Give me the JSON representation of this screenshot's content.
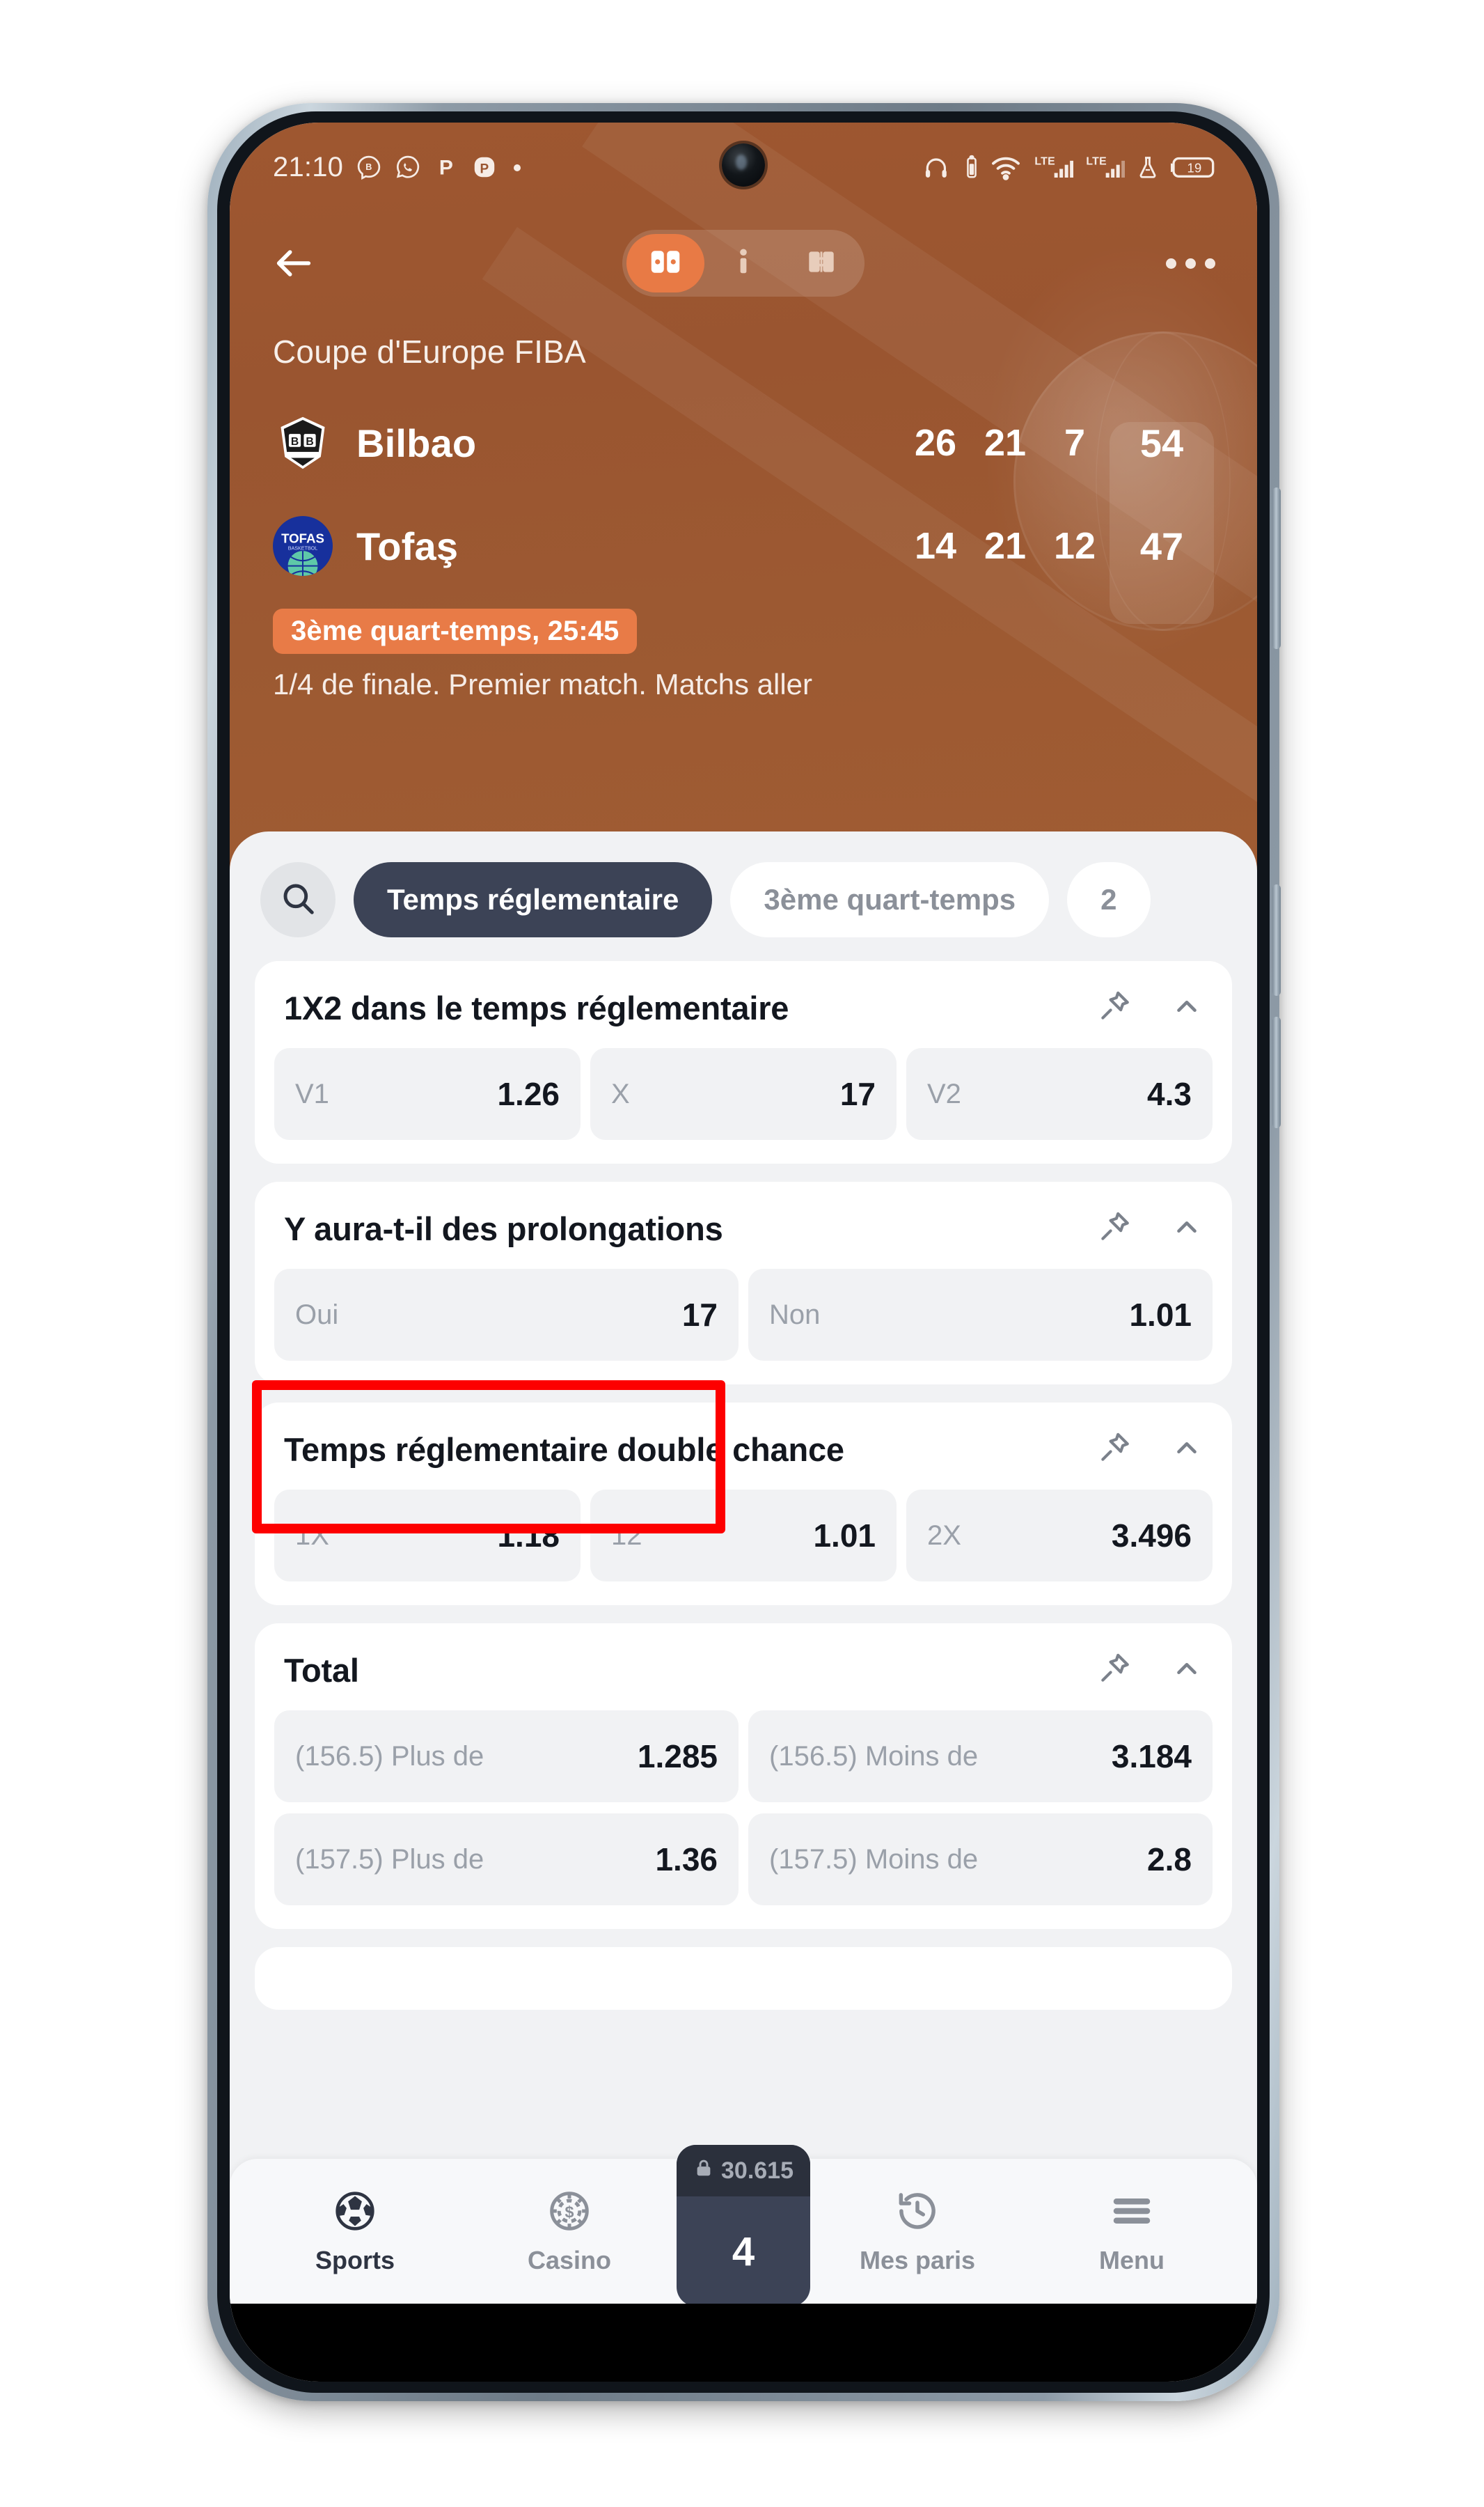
{
  "status_bar": {
    "time": "21:10",
    "left_icons": [
      "messenger-icon",
      "whatsapp-icon",
      "p-app-icon",
      "p-badge-icon",
      "dot-icon"
    ],
    "right_icons": [
      "headphones-icon",
      "battery-small-icon",
      "wifi-icon",
      "lte-signal-1-icon",
      "lte-signal-2-icon",
      "flask-icon"
    ],
    "battery_level": "19"
  },
  "nav": {
    "back_icon": "back-arrow-icon",
    "segments": [
      {
        "icon": "scoreboard-icon",
        "active": true
      },
      {
        "icon": "info-icon",
        "active": false
      },
      {
        "icon": "lineup-icon",
        "active": false
      }
    ],
    "more_icon": "more-options-icon"
  },
  "match": {
    "league": "Coupe d'Europe FIBA",
    "quarters_header": null,
    "teams": [
      {
        "name": "Bilbao",
        "logo": "bilbao-crest-logo",
        "quarters": [
          "26",
          "21",
          "7"
        ],
        "total": "54"
      },
      {
        "name": "Tofaş",
        "logo": "tofas-circle-logo",
        "quarters": [
          "14",
          "21",
          "12"
        ],
        "total": "47"
      }
    ],
    "live_status": "3ème quart-temps, 25:45",
    "stage_info": "1/4 de finale. Premier match. Matchs aller"
  },
  "filters": {
    "search_icon": "search-icon",
    "chips": [
      {
        "label": "Temps réglementaire",
        "active": true
      },
      {
        "label": "3ème quart-temps",
        "active": false
      },
      {
        "label": "2",
        "active": false
      }
    ]
  },
  "markets": [
    {
      "title": "1X2 dans le temps réglementaire",
      "pin_icon": "pin-icon",
      "collapse_icon": "chevron-up-icon",
      "rows": [
        [
          {
            "label": "V1",
            "value": "1.26"
          },
          {
            "label": "X",
            "value": "17"
          },
          {
            "label": "V2",
            "value": "4.3"
          }
        ]
      ]
    },
    {
      "title": "Y aura-t-il des prolongations",
      "pin_icon": "pin-icon",
      "collapse_icon": "chevron-up-icon",
      "highlighted": true,
      "rows": [
        [
          {
            "label": "Oui",
            "value": "17"
          },
          {
            "label": "Non",
            "value": "1.01"
          }
        ]
      ]
    },
    {
      "title": "Temps réglementaire double chance",
      "pin_icon": "pin-icon",
      "collapse_icon": "chevron-up-icon",
      "rows": [
        [
          {
            "label": "1X",
            "value": "1.18"
          },
          {
            "label": "12",
            "value": "1.01"
          },
          {
            "label": "2X",
            "value": "3.496"
          }
        ]
      ]
    },
    {
      "title": "Total",
      "pin_icon": "pin-icon",
      "collapse_icon": "chevron-up-icon",
      "rows": [
        [
          {
            "label": "(156.5) Plus de",
            "value": "1.285"
          },
          {
            "label": "(156.5) Moins de",
            "value": "3.184"
          }
        ],
        [
          {
            "label": "(157.5) Plus de",
            "value": "1.36"
          },
          {
            "label": "(157.5) Moins de",
            "value": "2.8"
          }
        ]
      ]
    }
  ],
  "bottom_nav": {
    "items": [
      {
        "label": "Sports",
        "icon": "soccer-ball-icon",
        "active": true
      },
      {
        "label": "Casino",
        "icon": "casino-chip-icon",
        "active": false
      },
      {
        "label": "Mes paris",
        "icon": "history-clock-icon",
        "active": false
      },
      {
        "label": "Menu",
        "icon": "hamburger-menu-icon",
        "active": false
      }
    ],
    "betslip": {
      "lock_icon": "lock-icon",
      "balance": "30.615",
      "count": "4"
    }
  },
  "colors": {
    "header_brown": "#9a5530",
    "accent_orange": "#e87b47",
    "dark_chip": "#3c4356",
    "annotation_red": "#fd0000",
    "sheet_bg": "#f1f2f4"
  }
}
